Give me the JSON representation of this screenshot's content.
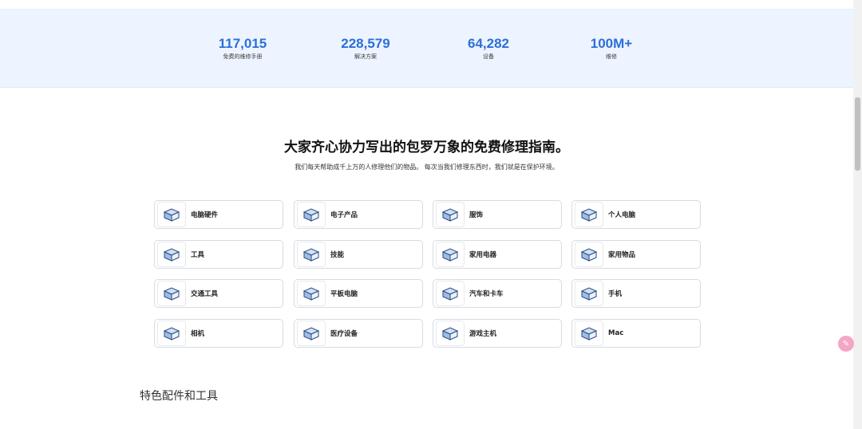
{
  "stats": [
    {
      "value": "117,015",
      "label": "免费的维修手册"
    },
    {
      "value": "228,579",
      "label": "解决方案"
    },
    {
      "value": "64,282",
      "label": "设备"
    },
    {
      "value": "100M+",
      "label": "维修"
    }
  ],
  "hero": {
    "title": "大家齐心协力写出的包罗万象的免费修理指南。",
    "subtitle": "我们每天帮助成千上万的人修理他们的物品。 每次当我们修理东西时，我们就是在保护环境。"
  },
  "categories": [
    {
      "label": "电脑硬件",
      "icon": "computer-hardware-icon"
    },
    {
      "label": "电子产品",
      "icon": "electronics-icon"
    },
    {
      "label": "服饰",
      "icon": "apparel-icon"
    },
    {
      "label": "个人电脑",
      "icon": "pc-icon"
    },
    {
      "label": "工具",
      "icon": "tools-icon"
    },
    {
      "label": "技能",
      "icon": "skills-icon"
    },
    {
      "label": "家用电器",
      "icon": "appliance-icon"
    },
    {
      "label": "家用物品",
      "icon": "household-icon"
    },
    {
      "label": "交通工具",
      "icon": "vehicle-icon"
    },
    {
      "label": "平板电脑",
      "icon": "tablet-icon"
    },
    {
      "label": "汽车和卡车",
      "icon": "car-truck-icon"
    },
    {
      "label": "手机",
      "icon": "phone-icon"
    },
    {
      "label": "相机",
      "icon": "camera-icon"
    },
    {
      "label": "医疗设备",
      "icon": "medical-icon"
    },
    {
      "label": "游戏主机",
      "icon": "game-console-icon"
    },
    {
      "label": "Mac",
      "icon": "mac-icon"
    }
  ],
  "featured": {
    "title": "特色配件和工具"
  },
  "colors": {
    "accent": "#2c6fd8",
    "stats_bg": "#edf4ff"
  }
}
